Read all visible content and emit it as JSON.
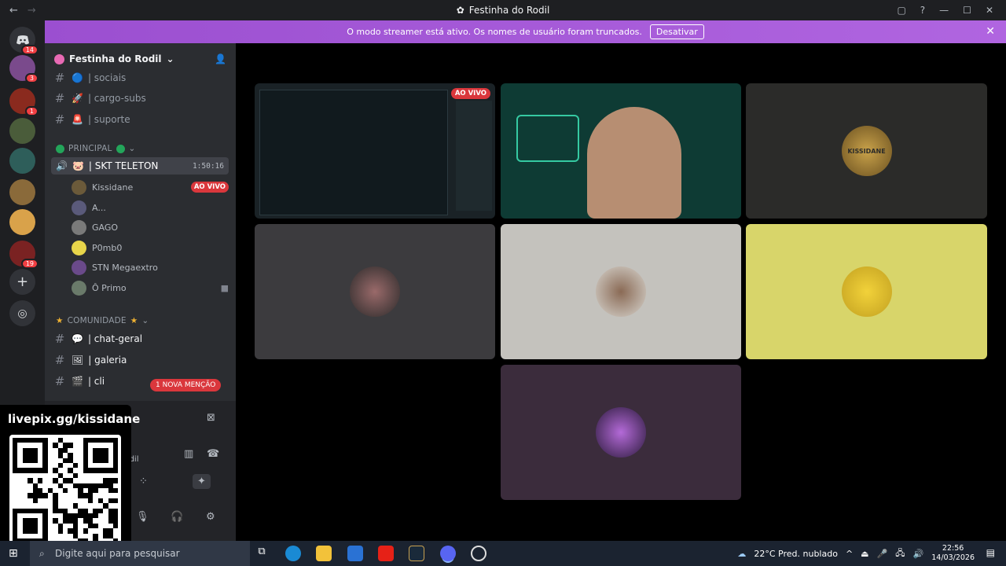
{
  "window": {
    "title": "Festinha do Rodil",
    "nav_back": "←",
    "nav_forward": "→",
    "controls": [
      "▢",
      "?",
      "—",
      "☐",
      "✕"
    ]
  },
  "banner": {
    "message": "O modo streamer está ativo. Os nomes de usuário foram truncados.",
    "button": "Desativar",
    "close": "✕"
  },
  "server_rail": {
    "badges": [
      "14",
      "3",
      "1",
      "19"
    ]
  },
  "sidebar": {
    "server_name": "Festinha do Rodil",
    "channels_top": [
      {
        "label": "| sociais"
      },
      {
        "label": "| cargo-subs"
      },
      {
        "label": "| suporte"
      }
    ],
    "category_principal": "PRINCIPAL",
    "voice_channel": {
      "label": "| SKT TELETON",
      "timer": "1:50:16"
    },
    "voice_users": [
      {
        "name": "Kissidane",
        "live": "AO VIVO"
      },
      {
        "name": "A..."
      },
      {
        "name": "GAGO"
      },
      {
        "name": "P0mb0"
      },
      {
        "name": "STN Megaextro"
      },
      {
        "name": "Ô Primo"
      }
    ],
    "category_comunidade": "COMUNIDADE",
    "channels_bottom": [
      {
        "label": "| chat-geral"
      },
      {
        "label": "| galeria"
      },
      {
        "label": "| cli"
      }
    ],
    "mention_pill": "1 NOVA MENÇÃO",
    "voice_panel_text": "a do Rodil"
  },
  "overlay": {
    "livepix": "livepix.gg/kissidane"
  },
  "stage": {
    "tiles": [
      {
        "live": "AO VIVO"
      },
      {},
      {
        "name_on_logo": "KISSIDANE"
      },
      {},
      {},
      {},
      {}
    ]
  },
  "taskbar": {
    "search_placeholder": "Digite aqui para pesquisar",
    "weather": "22°C  Pred. nublado",
    "time": "22:56",
    "date": "14/03/2026"
  }
}
